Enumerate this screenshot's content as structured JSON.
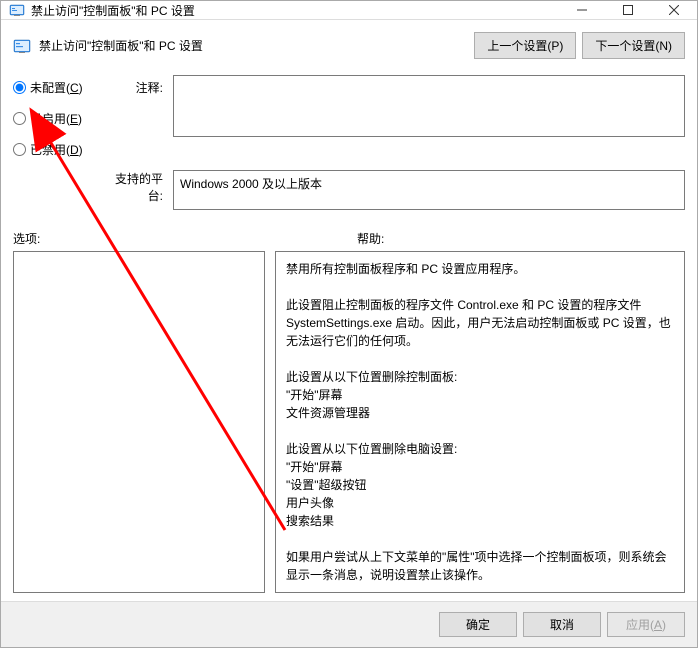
{
  "window": {
    "title": "禁止访问\"控制面板\"和 PC 设置"
  },
  "header": {
    "title": "禁止访问\"控制面板\"和 PC 设置",
    "prev": "上一个设置(P)",
    "next": "下一个设置(N)"
  },
  "radios": {
    "not_configured": "未配置(C)",
    "enabled": "已启用(E)",
    "disabled": "已禁用(D)"
  },
  "labels": {
    "comment": "注释:",
    "platform": "支持的平台:",
    "options": "选项:",
    "help": "帮助:"
  },
  "fields": {
    "comment": "",
    "platform": "Windows 2000 及以上版本"
  },
  "help_text": "禁用所有控制面板程序和 PC 设置应用程序。\n\n此设置阻止控制面板的程序文件 Control.exe 和 PC 设置的程序文件 SystemSettings.exe 启动。因此，用户无法启动控制面板或 PC 设置，也无法运行它们的任何项。\n\n此设置从以下位置删除控制面板:\n\"开始\"屏幕\n文件资源管理器\n\n此设置从以下位置删除电脑设置:\n\"开始\"屏幕\n\"设置\"超级按钮\n用户头像\n搜索结果\n\n如果用户尝试从上下文菜单的\"属性\"项中选择一个控制面板项，则系统会显示一条消息，说明设置禁止该操作。",
  "footer": {
    "ok": "确定",
    "cancel": "取消",
    "apply": "应用(A)"
  }
}
